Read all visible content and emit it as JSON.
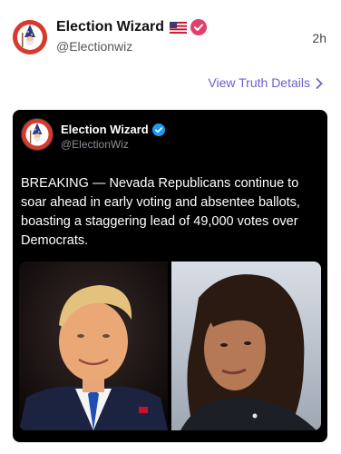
{
  "post": {
    "author_name": "Election Wizard",
    "author_flag": "🇺🇸",
    "author_handle": "@Electionwiz",
    "time": "2h",
    "details_link": "View Truth Details"
  },
  "embed": {
    "author_name": "Election Wizard",
    "author_handle": "@ElectionWiz",
    "text": "BREAKING — Nevada Republicans continue to soar ahead in early voting and absentee ballots, boasting a staggering lead of 49,000 votes over Democrats."
  },
  "icons": {
    "avatar": "wizard-avatar-icon",
    "flag": "us-flag-icon",
    "verified_pink": "verified-badge-icon",
    "verified_blue": "verified-check-icon",
    "chevron": "chevron-right-icon"
  },
  "colors": {
    "link": "#6b5fd0",
    "verified_pink": "#e0406a",
    "verified_blue": "#1d9bf0",
    "avatar_bg": "#d63a2c",
    "embed_bg": "#000000"
  }
}
